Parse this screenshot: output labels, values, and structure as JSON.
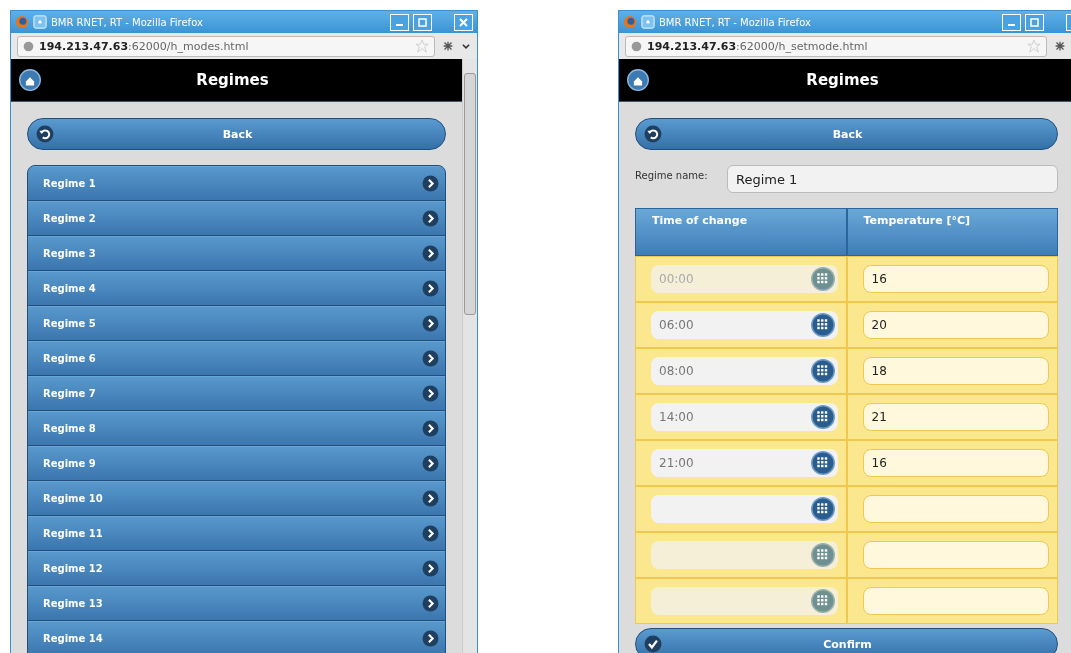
{
  "windows": [
    {
      "kind": "list",
      "title": "BMR RNET, RT - Mozilla Firefox",
      "url": "**194.213.47.63**:62000/h_modes.html",
      "header": "Regimes",
      "back": "Back",
      "regimes": [
        "Regime 1",
        "Regime 2",
        "Regime 3",
        "Regime 4",
        "Regime 5",
        "Regime 6",
        "Regime 7",
        "Regime 8",
        "Regime 9",
        "Regime 10",
        "Regime 11",
        "Regime 12",
        "Regime 13",
        "Regime 14"
      ]
    },
    {
      "kind": "form",
      "title": "BMR RNET, RT - Mozilla Firefox",
      "url": "**194.213.47.63**:62000/h_setmode.html",
      "header": "Regimes",
      "back": "Back",
      "name_label": "Regime name:",
      "name_value": "Regime 1",
      "columns": [
        "Time of change",
        "Temperature [°C]"
      ],
      "rows": [
        {
          "time": "00:00",
          "temperature": "16",
          "disabled": true
        },
        {
          "time": "06:00",
          "temperature": "20",
          "disabled": false
        },
        {
          "time": "08:00",
          "temperature": "18",
          "disabled": false
        },
        {
          "time": "14:00",
          "temperature": "21",
          "disabled": false
        },
        {
          "time": "21:00",
          "temperature": "16",
          "disabled": false
        },
        {
          "disabled": false
        },
        {
          "disabled": true
        },
        {
          "disabled": true
        }
      ],
      "confirm": "Confirm"
    }
  ]
}
